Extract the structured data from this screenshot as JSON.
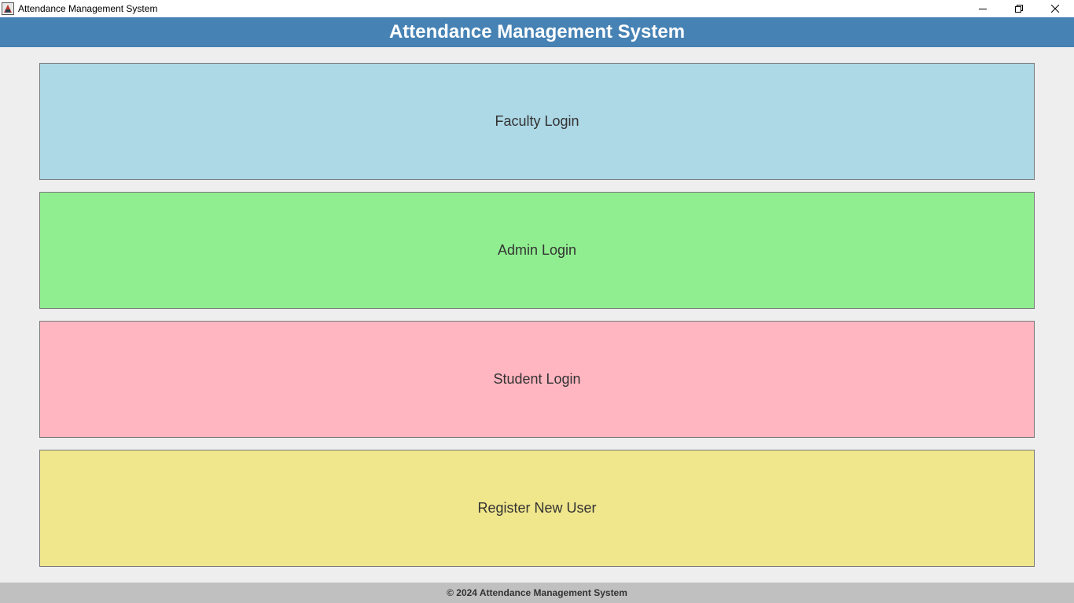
{
  "window": {
    "title": "Attendance Management System",
    "controls": {
      "minimize_icon": "minimize-icon",
      "maximize_icon": "restore-icon",
      "close_icon": "close-icon"
    }
  },
  "header": {
    "title": "Attendance Management System",
    "background": "#4682b4",
    "text_color": "#ffffff"
  },
  "buttons": [
    {
      "label": "Faculty Login",
      "color": "#add8e6"
    },
    {
      "label": "Admin Login",
      "color": "#90ee90"
    },
    {
      "label": "Student Login",
      "color": "#ffb6c1"
    },
    {
      "label": "Register New User",
      "color": "#f0e68c"
    }
  ],
  "footer": {
    "text": "© 2024 Attendance Management System",
    "background": "#c0c0c0"
  }
}
